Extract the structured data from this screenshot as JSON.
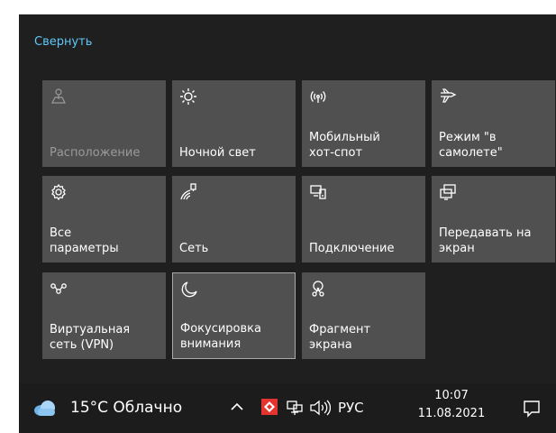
{
  "panel": {
    "collapse_label": "Свернуть",
    "tiles": [
      {
        "label": "Расположение",
        "icon": "location-icon",
        "state": "disabled"
      },
      {
        "label": "Ночной свет",
        "icon": "brightness-sun-icon",
        "state": "off"
      },
      {
        "label": "Мобильный\nхот-спот",
        "icon": "hotspot-icon",
        "state": "off"
      },
      {
        "label": "Режим \"в\nсамолете\"",
        "icon": "airplane-icon",
        "state": "off"
      },
      {
        "label": "Все\nпараметры",
        "icon": "gear-icon",
        "state": "off"
      },
      {
        "label": "Сеть",
        "icon": "network-icon",
        "state": "off"
      },
      {
        "label": "Подключение",
        "icon": "connect-icon",
        "state": "off"
      },
      {
        "label": "Передавать на\nэкран",
        "icon": "project-icon",
        "state": "off"
      },
      {
        "label": "Виртуальная\nсеть (VPN)",
        "icon": "vpn-icon",
        "state": "off"
      },
      {
        "label": "Фокусировка\nвнимания",
        "icon": "moon-icon",
        "state": "selected"
      },
      {
        "label": "Фрагмент\nэкрана",
        "icon": "snip-icon",
        "state": "off"
      }
    ]
  },
  "taskbar": {
    "weather": "15°C  Облачно",
    "language": "РУС",
    "time": "10:07",
    "date": "11.08.2021"
  },
  "colors": {
    "accent": "#60c6f5",
    "tile": "#505050",
    "panel": "#1f1f1f",
    "taskbar": "#1c1c1c"
  }
}
